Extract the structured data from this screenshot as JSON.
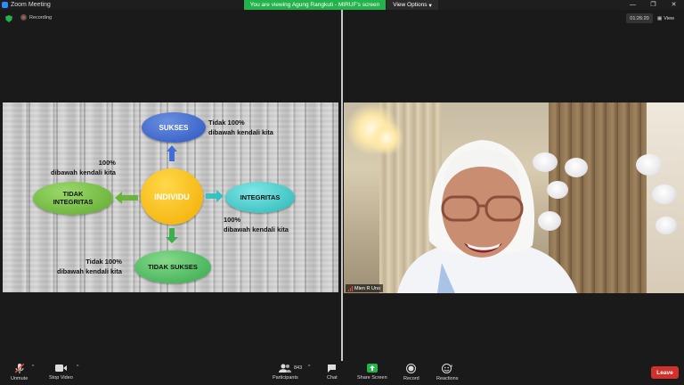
{
  "window": {
    "title": "Zoom Meeting",
    "viewing_banner": "You are viewing Agung Rangkuti - MIRUF's screen",
    "view_options": "View Options",
    "controls": [
      "—",
      "❐",
      "✕"
    ]
  },
  "status": {
    "recording": "Recording",
    "timer": "01:26:20",
    "view_label": "View"
  },
  "slide": {
    "nodes": {
      "sukses": "SUKSES",
      "individu": "INDIVIDU",
      "tidak_integritas": "TIDAK\nINTEGRITAS",
      "integritas": "INTEGRITAS",
      "tidak_sukses": "TIDAK SUKSES"
    },
    "annotations": {
      "top": "Tidak 100%\ndibawah kendali kita",
      "left": "100%\ndibawah kendali kita",
      "right": "100%\ndibawah kendali kita",
      "bottom": "Tidak 100%\ndibawah kendali kita"
    },
    "colors": {
      "sukses": "#2c56c0",
      "individu": "#f2ac00",
      "tidak_integritas": "#5fa82f",
      "integritas": "#28b7b5",
      "tidak_sukses": "#33a94b"
    }
  },
  "video": {
    "participant_name": "Mien R Uno"
  },
  "toolbar": {
    "unmute": "Unmute",
    "stop_video": "Stop Video",
    "participants": "Participants",
    "participant_count": "843",
    "chat": "Chat",
    "share_screen": "Share Screen",
    "record": "Record",
    "reactions": "Reactions",
    "leave": "Leave",
    "share_color": "#23b34b",
    "leave_color": "#d0312d"
  }
}
